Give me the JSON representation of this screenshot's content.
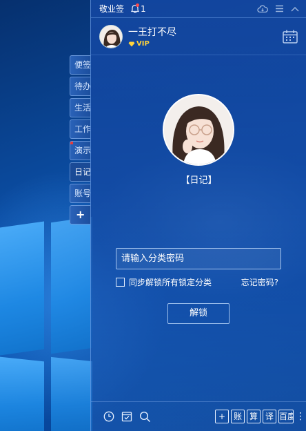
{
  "app": {
    "title": "敬业签",
    "notification_count": "1"
  },
  "user": {
    "name": "一王打不尽",
    "vip_label": "VIP"
  },
  "tabs": [
    {
      "label": "便签",
      "active": false,
      "flag": false
    },
    {
      "label": "待办",
      "active": false,
      "flag": false
    },
    {
      "label": "生活",
      "active": false,
      "flag": false
    },
    {
      "label": "工作",
      "active": false,
      "flag": false
    },
    {
      "label": "演示",
      "active": false,
      "flag": true
    },
    {
      "label": "日记",
      "active": true,
      "flag": false
    },
    {
      "label": "账号",
      "active": false,
      "flag": false
    },
    {
      "label": "+",
      "active": false,
      "flag": false
    }
  ],
  "lock": {
    "category_label": "【日记】",
    "password_placeholder": "请输入分类密码",
    "sync_label": "同步解锁所有锁定分类",
    "forgot_label": "忘记密码?",
    "unlock_label": "解锁"
  },
  "bottom": {
    "shortcuts": [
      "+",
      "账",
      "算",
      "译",
      "百度"
    ]
  },
  "icons": {
    "bell": "bell-icon",
    "cloud": "cloud-icon",
    "menu": "menu-icon",
    "collapse": "chevron-up-icon",
    "calendar": "calendar-icon",
    "clock": "clock-icon",
    "checklist": "checklist-icon",
    "search": "search-icon",
    "more": "more-icon"
  },
  "colors": {
    "accent": "#1a4a96",
    "vip": "#ffd33d",
    "alert": "#ff4b4b"
  }
}
